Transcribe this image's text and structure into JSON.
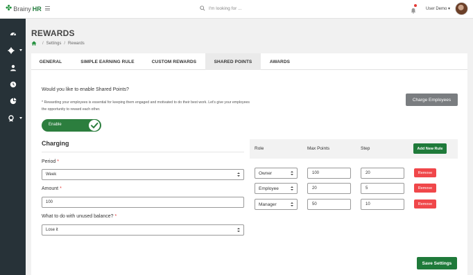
{
  "header": {
    "brand_left": "Brainy",
    "brand_right": "HR",
    "search_placeholder": "I'm looking for ...",
    "user_label": "User Demo ▾"
  },
  "sidebar": {
    "items": [
      {
        "icon": "dashboard-icon"
      },
      {
        "icon": "gear-icon",
        "has_caret": true
      },
      {
        "icon": "user-icon"
      },
      {
        "icon": "clock-icon"
      },
      {
        "icon": "pie-chart-icon"
      },
      {
        "icon": "award-icon",
        "has_caret": true
      }
    ]
  },
  "page": {
    "title": "REWARDS",
    "breadcrumb": [
      "Settings",
      "Rewards"
    ]
  },
  "tabs": [
    "GENERAL",
    "SIMPLE EARNING RULE",
    "CUSTOM REWARDS",
    "SHARED POINTS",
    "AWARDS"
  ],
  "active_tab": "SHARED POINTS",
  "shared": {
    "question": "Would you like to enable Shared Points?",
    "note": "* Rewarding your employees is essential for keeping them engaged and motivated to do their best work. Let's give your employees the opportunity to reward each other.",
    "charge_button": "Charge Employees",
    "toggle_label": "Enable",
    "toggle_on": true
  },
  "charging": {
    "title": "Charging",
    "period_label": "Period",
    "period_value": "Week",
    "amount_label": "Amount",
    "amount_value": "100",
    "unused_label": "What to do with unused balance?",
    "unused_value": "Lose it",
    "required_mark": "*"
  },
  "rules": {
    "headers": {
      "role": "Role",
      "max_points": "Max Points",
      "step": "Step"
    },
    "add_button": "Add New Rule",
    "remove_label": "Remove",
    "rows": [
      {
        "role": "Owner",
        "max_points": "100",
        "step": "20"
      },
      {
        "role": "Employee",
        "max_points": "20",
        "step": "5"
      },
      {
        "role": "Manager",
        "max_points": "50",
        "step": "10"
      }
    ]
  },
  "save_button": "Save Settings",
  "colors": {
    "accent": "#1f7a3a",
    "sidebar": "#273238",
    "danger": "#f0474a",
    "secondary": "#7a7d80"
  }
}
